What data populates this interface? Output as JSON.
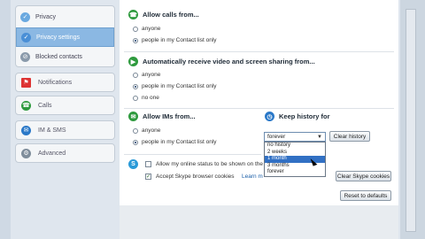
{
  "sidebar": {
    "group1": [
      {
        "label": "Privacy",
        "icon": "privacy-icon",
        "selected": false
      },
      {
        "label": "Privacy settings",
        "icon": "privacy-settings-icon",
        "selected": true
      },
      {
        "label": "Blocked contacts",
        "icon": "blocked-contacts-icon",
        "selected": false
      }
    ],
    "items": [
      {
        "label": "Notifications",
        "icon": "flag-icon"
      },
      {
        "label": "Calls",
        "icon": "phone-icon"
      },
      {
        "label": "IM & SMS",
        "icon": "chat-icon"
      },
      {
        "label": "Advanced",
        "icon": "gear-icon"
      }
    ]
  },
  "calls": {
    "heading": "Allow calls from...",
    "options": [
      "anyone",
      "people in my Contact list only"
    ],
    "selected_index": 1
  },
  "video": {
    "heading": "Automatically receive video and screen sharing from...",
    "options": [
      "anyone",
      "people in my Contact list only",
      "no one"
    ],
    "selected_index": 1
  },
  "ims": {
    "heading": "Allow IMs from...",
    "options": [
      "anyone",
      "people in my Contact list only"
    ],
    "selected_index": 1
  },
  "history": {
    "heading": "Keep history for",
    "selected_value": "forever",
    "clear_button": "Clear history",
    "options": [
      "no history",
      "2 weeks",
      "1 month",
      "3 months",
      "forever"
    ],
    "highlighted_index": 2
  },
  "online_status": {
    "label": "Allow my online status to be shown on the",
    "checked": false
  },
  "cookies": {
    "label": "Accept Skype browser cookies",
    "checked": true,
    "learn_more": "Learn m",
    "clear_button": "Clear Skype cookies"
  },
  "footer": {
    "reset_button": "Reset to defaults"
  },
  "colors": {
    "accent": "#3170c4",
    "selected_nav": "#8bb8e3",
    "section_icon_green": "#2e9a3e",
    "section_icon_blue": "#2a78c8"
  }
}
